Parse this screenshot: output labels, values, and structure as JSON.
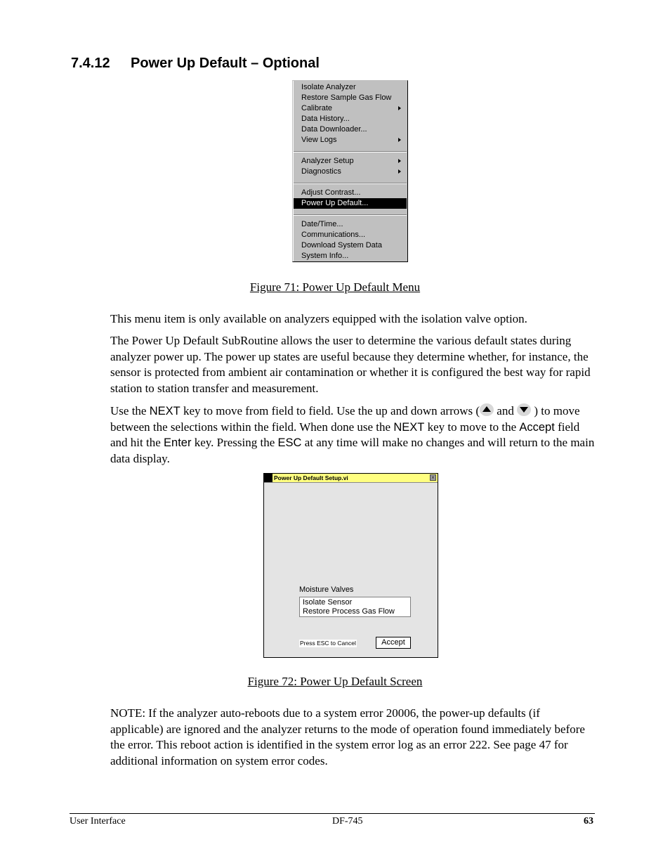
{
  "heading": {
    "number": "7.4.12",
    "title": "Power Up Default – Optional"
  },
  "menu": {
    "items": [
      {
        "label": "Isolate Analyzer",
        "submenu": false,
        "selected": false
      },
      {
        "label": "Restore Sample Gas Flow",
        "submenu": false,
        "selected": false
      },
      {
        "label": "Calibrate",
        "submenu": true,
        "selected": false
      },
      {
        "label": "Data History...",
        "submenu": false,
        "selected": false
      },
      {
        "label": "Data Downloader...",
        "submenu": false,
        "selected": false
      },
      {
        "label": "View Logs",
        "submenu": true,
        "selected": false
      },
      {
        "label": "Analyzer Setup",
        "submenu": true,
        "selected": false
      },
      {
        "label": "Diagnostics",
        "submenu": true,
        "selected": false
      },
      {
        "label": "Adjust Contrast...",
        "submenu": false,
        "selected": false
      },
      {
        "label": "Power Up Default...",
        "submenu": false,
        "selected": true
      },
      {
        "label": "Date/Time...",
        "submenu": false,
        "selected": false
      },
      {
        "label": "Communications...",
        "submenu": false,
        "selected": false
      },
      {
        "label": "Download System Data",
        "submenu": false,
        "selected": false
      },
      {
        "label": "System Info...",
        "submenu": false,
        "selected": false
      }
    ]
  },
  "figure71_caption": "Figure 71: Power Up Default Menu",
  "para1": "This menu item is only available on analyzers equipped with the isolation valve option.",
  "para2": "The Power Up Default SubRoutine allows the user to determine the various default states during analyzer power up.  The power up states are useful because they determine whether, for instance, the sensor is protected from ambient air contamination or whether it is configured the best way for rapid station to station transfer and measurement.",
  "para3": {
    "t1": "Use the ",
    "k1": "NEXT",
    "t2": " key to move from field to field. Use the up and down arrows (",
    "t3": " and ",
    "t4": " ) to move between the selections within the field. When done use the ",
    "k2": "NEXT",
    "t5": " key to move to the ",
    "k3": "Accept",
    "t6": " field and hit the ",
    "k4": "Enter",
    "t7": " key. Pressing the ",
    "k5": "ESC",
    "t8": " at any time will make no changes and will return to the main data display."
  },
  "dialog": {
    "title": "Power Up Default Setup.vi",
    "close_glyph": "×",
    "field_label": "Moisture Valves",
    "options": [
      "Isolate Sensor",
      "Restore Process Gas Flow"
    ],
    "esc_hint": "Press ESC to Cancel",
    "accept_label": "Accept"
  },
  "figure72_caption": "Figure 72: Power Up Default Screen",
  "note": "NOTE: If the analyzer auto-reboots due to a system error 20006, the power-up defaults (if applicable) are ignored and the analyzer returns to the mode of operation found immediately before the error. This reboot action is identified in the system error log as an error 222. See page 47 for additional information on system error codes.",
  "footer": {
    "left": "User Interface",
    "center": "DF-745",
    "page": "63"
  }
}
